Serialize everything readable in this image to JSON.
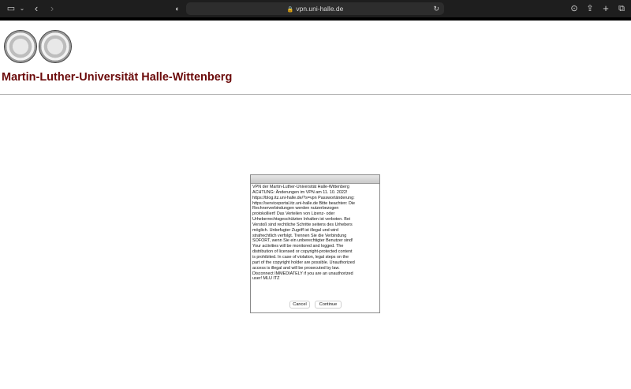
{
  "browser": {
    "url": "vpn.uni-halle.de"
  },
  "page": {
    "title": "Martin-Luther-Universität Halle-Wittenberg"
  },
  "dialog": {
    "message": "VPN der Martin-Luther-Universität Halle-Wittenberg\nACHTUNG: Änderungen im VPN am 11. 10. 2022!\nhttps://blog.itz.uni-halle.de/?s=vpn Passwortänderung:\nhttps://serviceportal.itz.uni-halle.de Bitte beachten: Die\nRechnerverbindungen werden nutzerbezogen\nprotokolliert! Das Verteilen von Lizenz- oder\nUrheberrechtsgeschützten Inhalten ist verboten. Bei\nVerstoß sind rechtliche Schritte seitens des Urhebers\nmöglich. Unbefugter Zugriff ist illegal und wird\nstrafrechtlich verfolgt. Trennen Sie die Verbindung\nSOFORT, wenn Sie ein unberechtigter Benutzer sind!\nYour activities will be monitored and logged. The\ndistribution of licensed or copyright-protected content\nis prohibited. In case of violation, legal steps on the\npart of the copyright holder are possible. Unauthorized\naccess is illegal and will be prosecuted by law.\nDisconnect IMMEDIATELY if you are an unauthorized\nuser! MLU ITZ",
    "cancel_label": "Cancel",
    "continue_label": "Continue"
  }
}
